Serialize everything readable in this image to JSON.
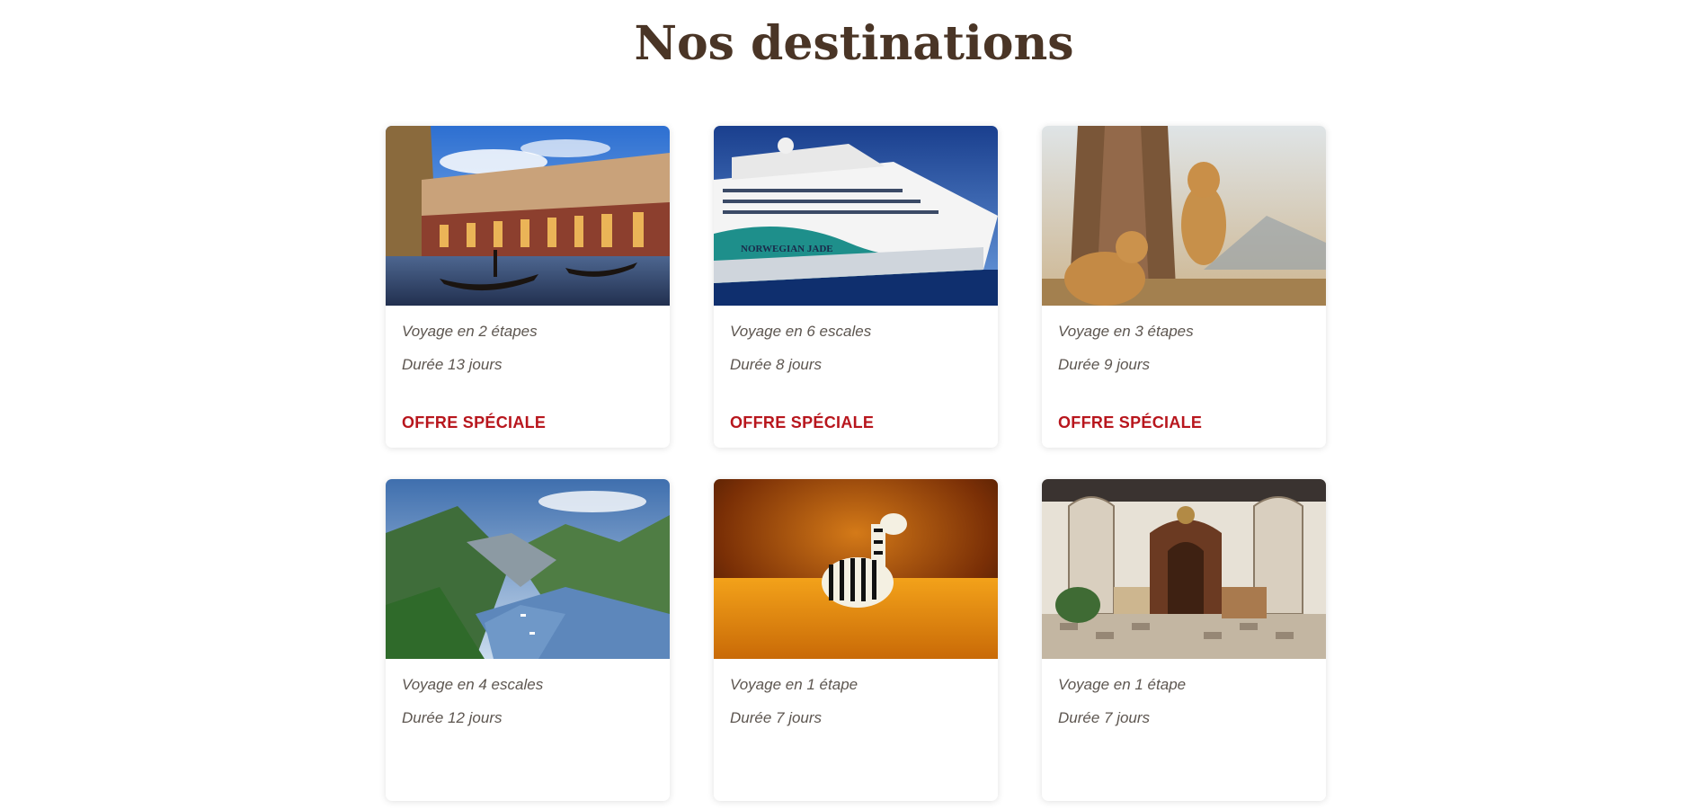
{
  "page": {
    "title": "Nos destinations"
  },
  "cards": [
    {
      "image": "venice-gondola-canal-photo",
      "line1": "Voyage en 2 étapes",
      "line2": "Durée 13 jours",
      "offer": "OFFRE SPÉCIALE"
    },
    {
      "image": "cruise-ship-norwegian-jade-photo",
      "line1": "Voyage en 6 escales",
      "line2": "Durée 8 jours",
      "offer": "OFFRE SPÉCIALE",
      "ship_name": "NORWEGIAN JADE"
    },
    {
      "image": "lionesses-savanna-photo",
      "line1": "Voyage en 3 étapes",
      "line2": "Durée 9 jours",
      "offer": "OFFRE SPÉCIALE"
    },
    {
      "image": "norway-fjord-photo",
      "line1": "Voyage en 4 escales",
      "line2": "Durée 12 jours",
      "offer": ""
    },
    {
      "image": "zebra-golden-grass-photo",
      "line1": "Voyage en 1 étape",
      "line2": "Durée 7 jours",
      "offer": ""
    },
    {
      "image": "moorish-palace-hall-photo",
      "line1": "Voyage en 1 étape",
      "line2": "Durée 7 jours",
      "offer": ""
    }
  ],
  "colors": {
    "title": "#4a3526",
    "offer": "#b8161d",
    "meta": "#5d5650"
  }
}
